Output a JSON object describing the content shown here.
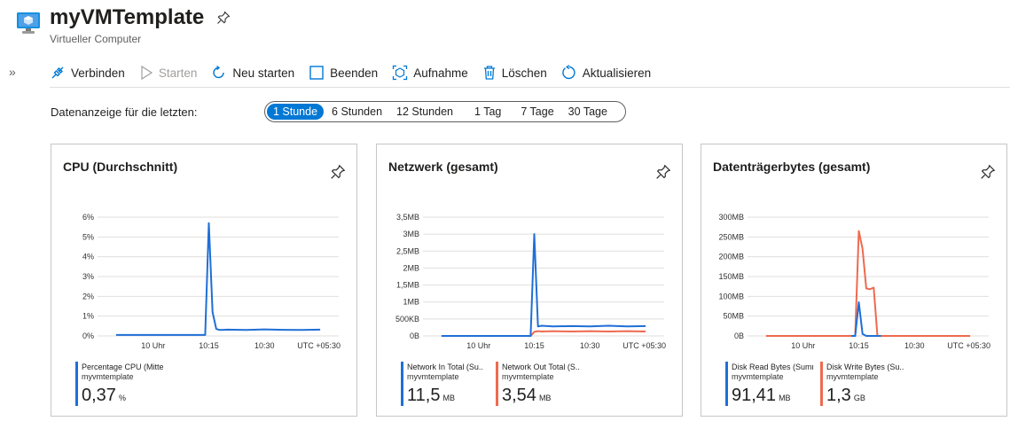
{
  "header": {
    "title": "myVMTemplate",
    "subtitle": "Virtueller Computer"
  },
  "toolbar": [
    {
      "label": "Verbinden",
      "icon": "connect-icon",
      "enabled": true
    },
    {
      "label": "Starten",
      "icon": "play-icon",
      "enabled": false
    },
    {
      "label": "Neu starten",
      "icon": "restart-icon",
      "enabled": true
    },
    {
      "label": "Beenden",
      "icon": "stop-icon",
      "enabled": true
    },
    {
      "label": "Aufnahme",
      "icon": "capture-icon",
      "enabled": true
    },
    {
      "label": "Löschen",
      "icon": "trash-icon",
      "enabled": true
    },
    {
      "label": "Aktualisieren",
      "icon": "refresh-icon",
      "enabled": true
    }
  ],
  "range": {
    "label": "Datenanzeige für die letzten:",
    "options": [
      "1 Stunde",
      "6 Stunden",
      "12 Stunden",
      "1 Tag",
      "7 Tage",
      "30 Tage"
    ],
    "selected": "1 Stunde"
  },
  "colors": {
    "accent": "#0078d4",
    "series_blue": "#1f6fd6",
    "series_orange": "#ee6a4f"
  },
  "chart_data": [
    {
      "type": "line",
      "title": "CPU (Durchschnitt)",
      "x_ticks": [
        "10 Uhr",
        "10:15",
        "10:30"
      ],
      "timezone_label": "UTC +05:30",
      "y_ticks": [
        "6%",
        "5%",
        "4%",
        "3%",
        "2%",
        "1%",
        "0%"
      ],
      "ylim": [
        0,
        6
      ],
      "x": [
        "09:50",
        "09:55",
        "10:00",
        "10:05",
        "10:10",
        "10:14",
        "10:15",
        "10:16",
        "10:17",
        "10:18",
        "10:20",
        "10:25",
        "10:30",
        "10:35",
        "10:40",
        "10:45"
      ],
      "series": [
        {
          "name": "Percentage CPU (Mittelw)",
          "resource": "myvmtemplate",
          "summary_value": "0,37",
          "summary_unit": "%",
          "color": "#1f6fd6",
          "values": [
            0.05,
            0.05,
            0.05,
            0.05,
            0.05,
            0.05,
            5.7,
            1.2,
            0.35,
            0.3,
            0.32,
            0.3,
            0.33,
            0.31,
            0.3,
            0.32
          ]
        }
      ]
    },
    {
      "type": "line",
      "title": "Netzwerk (gesamt)",
      "x_ticks": [
        "10 Uhr",
        "10:15",
        "10:30"
      ],
      "timezone_label": "UTC +05:30",
      "y_ticks": [
        "3,5MB",
        "3MB",
        "2,5MB",
        "2MB",
        "1,5MB",
        "1MB",
        "500KB",
        "0B"
      ],
      "ylim": [
        0,
        3.5
      ],
      "x": [
        "09:50",
        "09:55",
        "10:00",
        "10:05",
        "10:10",
        "10:14",
        "10:15",
        "10:16",
        "10:17",
        "10:20",
        "10:25",
        "10:30",
        "10:35",
        "10:40",
        "10:45"
      ],
      "series": [
        {
          "name": "Network In Total (Su..",
          "resource": "myvmtemplate",
          "summary_value": "11,5",
          "summary_unit": "MB",
          "color": "#1f6fd6",
          "values": [
            0,
            0,
            0,
            0,
            0,
            0,
            3.0,
            0.28,
            0.3,
            0.28,
            0.29,
            0.28,
            0.3,
            0.28,
            0.29
          ]
        },
        {
          "name": "Network Out Total (S..",
          "resource": "myvmtemplate",
          "summary_value": "3,54",
          "summary_unit": "MB",
          "color": "#ee6a4f",
          "values": [
            0,
            0,
            0,
            0,
            0,
            0,
            0.12,
            0.14,
            0.13,
            0.14,
            0.13,
            0.14,
            0.13,
            0.14,
            0.13
          ]
        }
      ]
    },
    {
      "type": "line",
      "title": "Datenträgerbytes (gesamt)",
      "x_ticks": [
        "10 Uhr",
        "10:15",
        "10:30"
      ],
      "timezone_label": "UTC +05:30",
      "y_ticks": [
        "300MB",
        "250MB",
        "200MB",
        "150MB",
        "100MB",
        "50MB",
        "0B"
      ],
      "ylim": [
        0,
        300
      ],
      "x": [
        "09:50",
        "09:55",
        "10:00",
        "10:05",
        "10:10",
        "10:13",
        "10:14",
        "10:15",
        "10:16",
        "10:17",
        "10:18",
        "10:19",
        "10:20",
        "10:21",
        "10:22",
        "10:25",
        "10:30",
        "10:35",
        "10:40",
        "10:45"
      ],
      "series": [
        {
          "name": "Disk Read Bytes (Summe)",
          "resource": "myvmtemplate",
          "summary_value": "91,41",
          "summary_unit": "MB",
          "color": "#1f6fd6",
          "values": [
            null,
            null,
            null,
            null,
            null,
            0,
            0,
            85,
            5,
            0,
            0,
            0,
            0,
            0,
            null,
            null,
            null,
            null,
            null,
            null
          ]
        },
        {
          "name": "Disk Write Bytes (Su..",
          "resource": "myvmtemplate",
          "summary_value": "1,3",
          "summary_unit": "GB",
          "color": "#ee6a4f",
          "values": [
            0,
            0,
            0,
            0,
            0,
            0,
            0,
            265,
            220,
            120,
            118,
            122,
            0,
            0,
            0,
            0,
            0,
            0,
            0,
            0
          ]
        }
      ]
    }
  ]
}
